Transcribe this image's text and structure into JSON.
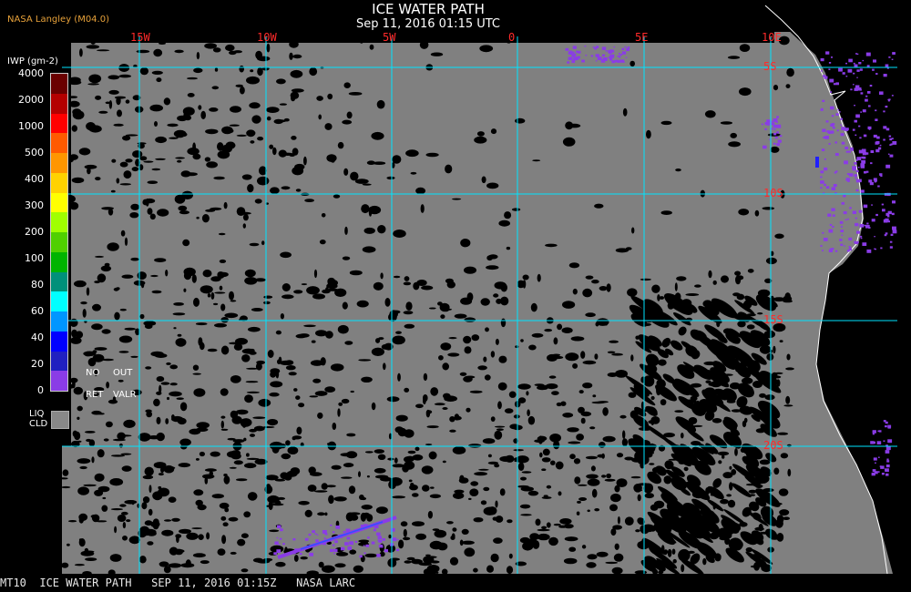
{
  "header": {
    "title": "ICE WATER PATH",
    "subtitle": "Sep 11, 2016 01:15 UTC",
    "credit": "NASA Langley (M04.0)"
  },
  "legend": {
    "unit_label": "IWP (gm-2)",
    "colors": [
      "#6a0000",
      "#b40000",
      "#ff0000",
      "#ff5a00",
      "#ff9600",
      "#ffd200",
      "#ffff00",
      "#a0ff00",
      "#50d000",
      "#00b400",
      "#00907a",
      "#00ffff",
      "#0096ff",
      "#0000ff",
      "#2020c0",
      "#8a3ce6"
    ],
    "values": [
      "4000",
      "2000",
      "1000",
      "500",
      "400",
      "300",
      "200",
      "100",
      "80",
      "60",
      "40",
      "20",
      "0"
    ],
    "no_ret": [
      "NO",
      "RET"
    ],
    "out_valr": [
      "OUT",
      "VALR"
    ],
    "liq_cld": [
      "LIQ",
      "CLD"
    ],
    "liq_color": "#888888"
  },
  "map": {
    "lon_labels": [
      "15W",
      "10W",
      "5W",
      "0",
      "5E",
      "10E"
    ],
    "lat_labels": [
      "5S",
      "10S",
      "15S",
      "20S"
    ],
    "background_color": "#808080",
    "grid_color": "#00e5ff",
    "label_color": "#ff2a2a"
  },
  "footer": {
    "text": "MT10  ICE WATER PATH   SEP 11, 2016 01:15Z   NASA LARC"
  }
}
